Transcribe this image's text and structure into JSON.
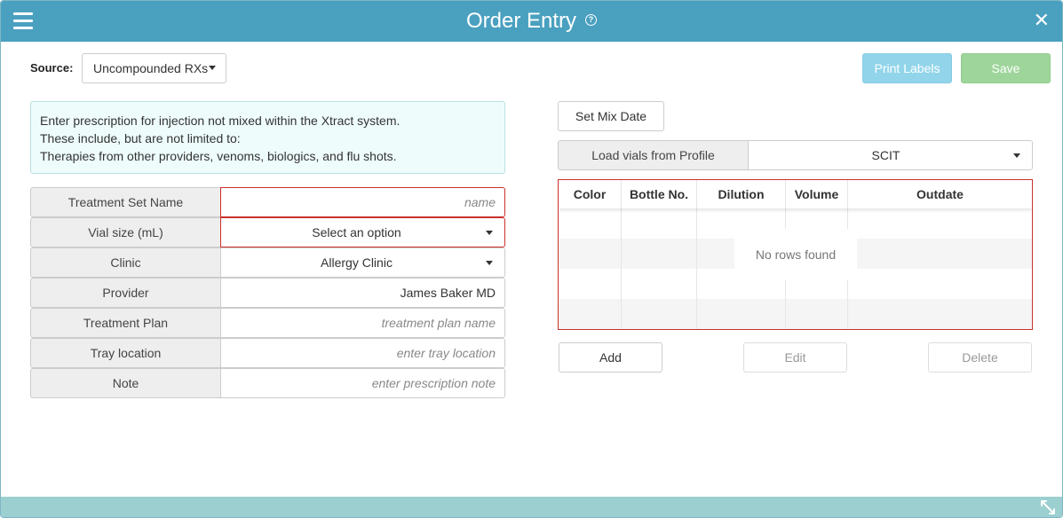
{
  "window": {
    "title": "Order Entry"
  },
  "source": {
    "label": "Source:",
    "value": "Uncompounded RXs"
  },
  "actions": {
    "print_labels": "Print Labels",
    "save": "Save"
  },
  "info": {
    "lines": [
      "Enter prescription for injection not mixed within the Xtract system.",
      "These include, but are not limited to:",
      "Therapies from other providers, venoms, biologics, and flu shots."
    ]
  },
  "form": {
    "treatment_set_name": {
      "label": "Treatment Set Name",
      "placeholder": "name"
    },
    "vial_size": {
      "label": "Vial size (mL)",
      "value": "Select an option"
    },
    "clinic": {
      "label": "Clinic",
      "value": "Allergy Clinic"
    },
    "provider": {
      "label": "Provider",
      "value": "James Baker MD"
    },
    "treatment_plan": {
      "label": "Treatment Plan",
      "placeholder": "treatment plan name"
    },
    "tray_location": {
      "label": "Tray location",
      "placeholder": "enter tray location"
    },
    "note": {
      "label": "Note",
      "placeholder": "enter prescription note"
    }
  },
  "mix": {
    "set_mix_date": "Set Mix Date"
  },
  "profile": {
    "load_label": "Load vials from Profile",
    "value": "SCIT"
  },
  "grid": {
    "columns": [
      "Color",
      "Bottle No.",
      "Dilution",
      "Volume",
      "Outdate"
    ],
    "empty_text": "No rows found"
  },
  "grid_actions": {
    "add": "Add",
    "edit": "Edit",
    "delete": "Delete"
  },
  "colors": {
    "titlebar": "#4aa0bf",
    "footer": "#9bcfd0",
    "invalid_border": "#c9302c",
    "info_bg": "#eefcfc"
  },
  "icons": {
    "menu": "hamburger-icon",
    "help": "question-circle-icon",
    "close": "close-icon",
    "resize": "resize-icon"
  }
}
